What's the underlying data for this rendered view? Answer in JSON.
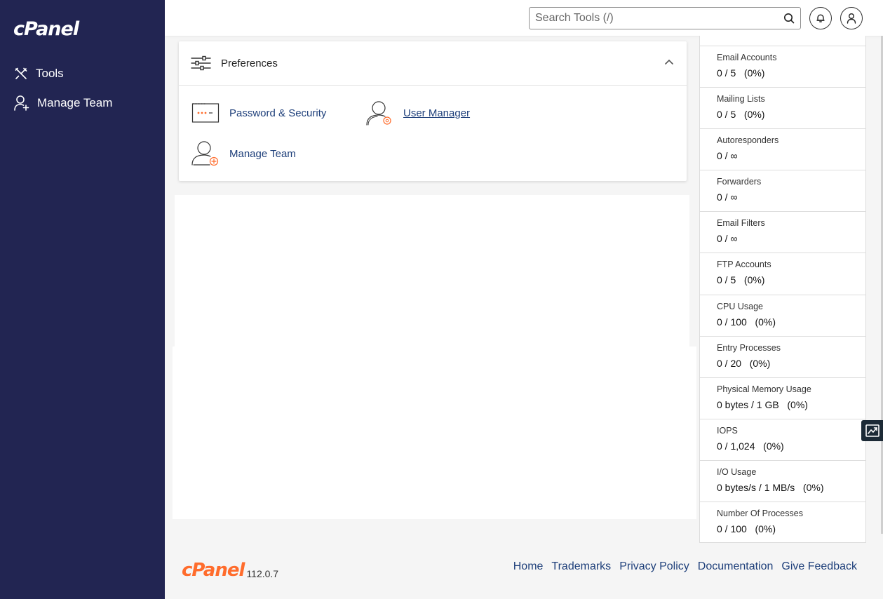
{
  "sidebar": {
    "logo": "cPanel",
    "items": [
      {
        "label": "Tools",
        "icon": "tools-icon"
      },
      {
        "label": "Manage Team",
        "icon": "user-add-icon"
      }
    ]
  },
  "header": {
    "search_placeholder": "Search Tools (/)"
  },
  "preferences": {
    "title": "Preferences",
    "tools": [
      {
        "label": "Password & Security",
        "icon": "password-icon"
      },
      {
        "label": "User Manager",
        "icon": "user-manager-icon"
      },
      {
        "label": "Manage Team",
        "icon": "manage-team-icon"
      }
    ]
  },
  "stats": [
    {
      "label": "Email Accounts",
      "value": "0 / 5   (0%)"
    },
    {
      "label": "Mailing Lists",
      "value": "0 / 5   (0%)"
    },
    {
      "label": "Autoresponders",
      "value": "0 / ∞"
    },
    {
      "label": "Forwarders",
      "value": "0 / ∞"
    },
    {
      "label": "Email Filters",
      "value": "0 / ∞"
    },
    {
      "label": "FTP Accounts",
      "value": "0 / 5   (0%)"
    },
    {
      "label": "CPU Usage",
      "value": "0 / 100   (0%)"
    },
    {
      "label": "Entry Processes",
      "value": "0 / 20   (0%)"
    },
    {
      "label": "Physical Memory Usage",
      "value": "0 bytes / 1 GB   (0%)"
    },
    {
      "label": "IOPS",
      "value": "0 / 1,024   (0%)"
    },
    {
      "label": "I/O Usage",
      "value": "0 bytes/s / 1 MB/s   (0%)"
    },
    {
      "label": "Number Of Processes",
      "value": "0 / 100   (0%)"
    }
  ],
  "footer": {
    "brand": "cPanel",
    "version": "112.0.7",
    "links": [
      "Home",
      "Trademarks",
      "Privacy Policy",
      "Documentation",
      "Give Feedback"
    ]
  },
  "colors": {
    "sidebar_bg": "#222552",
    "brand_orange": "#ff6c2c",
    "link_blue": "#1e3f7a"
  }
}
